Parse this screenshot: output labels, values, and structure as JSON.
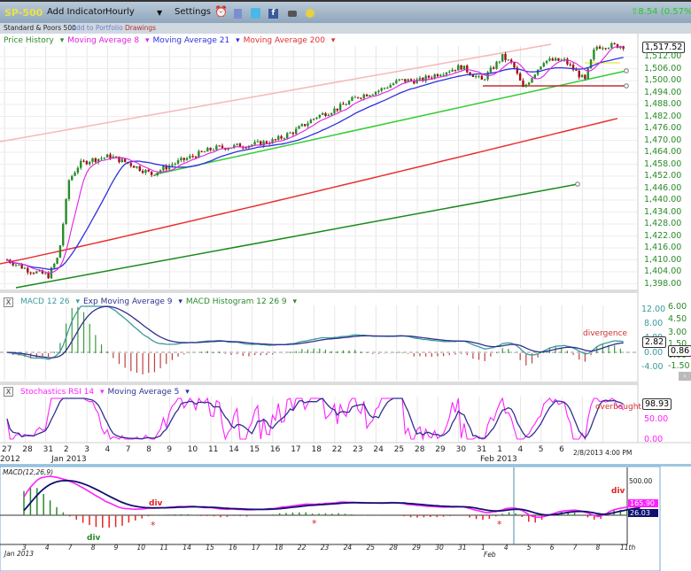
{
  "toolbar": {
    "symbol": "SP-500",
    "add_indicator": "Add Indicator",
    "interval": "Hourly",
    "settings": "Settings",
    "change": "8.54 (0.57%)",
    "change_color": "#22cc22",
    "icons": [
      "alarm-clock-icon",
      "portfolio-icon",
      "twitter-icon",
      "facebook-icon",
      "camera-icon",
      "smiley-icon"
    ]
  },
  "subbar": {
    "name": "Standard & Poors 500",
    "add_to_portfolio": "Add to Portfolio",
    "drawings": "Drawings"
  },
  "price_panel": {
    "legend": [
      "Price History",
      "Moving Average 8",
      "Moving Average 21",
      "Moving Average 200"
    ],
    "legend_colors": [
      "#2a8a2a",
      "#e020e0",
      "#3030e0",
      "#e03030"
    ],
    "last_price": "1,517.52",
    "y_ticks": [
      "1,512.00",
      "1,506.00",
      "1,500.00",
      "1,494.00",
      "1,488.00",
      "1,482.00",
      "1,476.00",
      "1,470.00",
      "1,464.00",
      "1,458.00",
      "1,452.00",
      "1,446.00",
      "1,440.00",
      "1,434.00",
      "1,428.00",
      "1,422.00",
      "1,416.00",
      "1,410.00",
      "1,404.00",
      "1,398.00"
    ]
  },
  "macd_panel": {
    "close": "X",
    "legend": [
      "MACD 12 26",
      "Exp Moving Average 9",
      "MACD Histogram 12 26 9"
    ],
    "legend_colors": [
      "#3a9a9a",
      "#303090",
      "#2a8a2a"
    ],
    "annotation": "divergence",
    "left_ticks": [
      "12.00",
      "8.00",
      "4.00",
      "0.00",
      "-4.00"
    ],
    "left_value": "2.82",
    "right_ticks": [
      "6.00",
      "4.50",
      "3.00",
      "1.50",
      "0.00",
      "-1.50"
    ],
    "right_value": "0.86"
  },
  "stoch_panel": {
    "close": "X",
    "legend": [
      "Stochastics RSI 14",
      "Moving Average 5"
    ],
    "legend_colors": [
      "#ff20ff",
      "#303090"
    ],
    "annotation": "overbought",
    "ticks": [
      "50.00",
      "0.00"
    ],
    "value": "98.93"
  },
  "x_axis": {
    "dates": [
      "27",
      "28",
      "31",
      "2",
      "3",
      "4",
      "7",
      "8",
      "9",
      "10",
      "11",
      "14",
      "15",
      "16",
      "17",
      "18",
      "22",
      "23",
      "24",
      "25",
      "28",
      "29",
      "30",
      "31",
      "1",
      "4",
      "5",
      "6"
    ],
    "year_2012": "2012",
    "month_jan": "Jan 2013",
    "month_feb": "Feb 2013",
    "timestamp": "2/8/2013 4:00 PM"
  },
  "bottom_panel": {
    "title": "MACD(12,26,9)",
    "dates": [
      "3",
      "4",
      "7",
      "8",
      "9",
      "10",
      "11",
      "14",
      "15",
      "16",
      "17",
      "18",
      "22",
      "23",
      "24",
      "25",
      "28",
      "29",
      "30",
      "31",
      "1",
      "4",
      "5",
      "6",
      "7",
      "8",
      "11th"
    ],
    "month_jan": "Jan 2013",
    "month_feb": "Feb",
    "tick": "500.00",
    "macd_value": "165.90",
    "signal_value": "26.03",
    "annotations": [
      "div",
      "div",
      "div"
    ]
  },
  "chart_data": {
    "type": "line",
    "title": "SP-500 Hourly",
    "dates": [
      "Dec 27",
      "Dec 28",
      "Dec 31",
      "Jan 2",
      "Jan 3",
      "Jan 4",
      "Jan 7",
      "Jan 8",
      "Jan 9",
      "Jan 10",
      "Jan 11",
      "Jan 14",
      "Jan 15",
      "Jan 16",
      "Jan 17",
      "Jan 18",
      "Jan 22",
      "Jan 23",
      "Jan 24",
      "Jan 25",
      "Jan 28",
      "Jan 29",
      "Jan 30",
      "Jan 31",
      "Feb 1",
      "Feb 4",
      "Feb 5",
      "Feb 6",
      "Feb 7",
      "Feb 8"
    ],
    "price_keypoints": [
      [
        0,
        1410
      ],
      [
        1,
        1405
      ],
      [
        2,
        1402
      ],
      [
        2.5,
        1412
      ],
      [
        3,
        1450
      ],
      [
        3.5,
        1458
      ],
      [
        4,
        1460
      ],
      [
        5,
        1462
      ],
      [
        6,
        1458
      ],
      [
        7,
        1453
      ],
      [
        8,
        1458
      ],
      [
        9,
        1462
      ],
      [
        10,
        1466
      ],
      [
        11,
        1467
      ],
      [
        12,
        1468
      ],
      [
        13,
        1470
      ],
      [
        14,
        1475
      ],
      [
        15,
        1482
      ],
      [
        16,
        1486
      ],
      [
        17,
        1492
      ],
      [
        18,
        1495
      ],
      [
        19,
        1500
      ],
      [
        20,
        1500
      ],
      [
        21,
        1504
      ],
      [
        22,
        1507
      ],
      [
        23,
        1500
      ],
      [
        24,
        1512
      ],
      [
        24.5,
        1508
      ],
      [
        25,
        1496
      ],
      [
        26,
        1510
      ],
      [
        27,
        1510
      ],
      [
        28,
        1500
      ],
      [
        28.5,
        1517
      ],
      [
        29,
        1517.52
      ]
    ],
    "ma200_range": [
      1408,
      1481
    ],
    "ylim": [
      1396,
      1522
    ]
  }
}
